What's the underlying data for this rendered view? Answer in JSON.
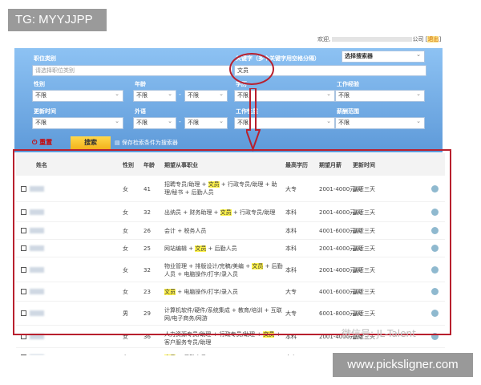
{
  "watermark_tag": "TG: MYYJJPP",
  "header": {
    "welcome": "欢迎,",
    "company_suffix": "公司",
    "logout": "退出"
  },
  "search": {
    "job_category_label": "职位类别",
    "job_category_placeholder": "请选择职位类别",
    "keyword_label": "关键字（多个关键字用空格分隔）",
    "keyword_value": "文员",
    "searcher_select": "选择搜索器",
    "gender_label": "性别",
    "gender_value": "不限",
    "age_label": "年龄",
    "age_from": "不限",
    "age_to": "不限",
    "education_label": "学历",
    "education_value": "不限",
    "experience_label": "工作经验",
    "experience_value": "不限",
    "update_label": "更新时间",
    "update_value": "不限",
    "language_label": "外语",
    "language_from": "不限",
    "language_to": "不限",
    "nature_label": "工作性质",
    "nature_value": "不限",
    "salary_label": "薪酬范围",
    "salary_value": "不限",
    "reset": "重置",
    "search_button": "搜索",
    "save_searcher": "保存检索条件为搜索器"
  },
  "table": {
    "columns": [
      "姓名",
      "性别",
      "年龄",
      "期望从事职业",
      "最高学历",
      "期望月薪",
      "更新时间"
    ],
    "rows": [
      {
        "gender": "女",
        "age": "41",
        "job": [
          "招聘专员/助理 + ",
          "文员",
          " + 行政专员/助理 + 助理/秘书 + 后勤人员"
        ],
        "edu": "大专",
        "salary": "2001-4000元/月",
        "updated": "最近三天"
      },
      {
        "gender": "女",
        "age": "32",
        "job": [
          "出纳员 + 财务助理 + ",
          "文员",
          " + 行政专员/助理"
        ],
        "edu": "本科",
        "salary": "2001-4000元/月",
        "updated": "最近三天"
      },
      {
        "gender": "女",
        "age": "26",
        "job": [
          "会计 + 税务人员",
          "",
          ""
        ],
        "edu": "本科",
        "salary": "4001-6000元/月",
        "updated": "最近三天"
      },
      {
        "gender": "女",
        "age": "25",
        "job": [
          "网站编辑 + ",
          "文员",
          " + 后勤人员"
        ],
        "edu": "本科",
        "salary": "2001-4000元/月",
        "updated": "最近三天"
      },
      {
        "gender": "女",
        "age": "32",
        "job": [
          "物业管理 + 排版设计/完稿/美编 + ",
          "文员",
          " + 后勤人员 + 电脑操作/打字/录入员"
        ],
        "edu": "本科",
        "salary": "2001-4000元/月",
        "updated": "最近三天"
      },
      {
        "gender": "女",
        "age": "23",
        "job": [
          "",
          "文员",
          " + 电脑操作/打字/录入员"
        ],
        "edu": "大专",
        "salary": "4001-6000元/月",
        "updated": "最近三天"
      },
      {
        "gender": "男",
        "age": "29",
        "job": [
          "计算机软件/硬件/系统集成 + 教育/培训 + 互联网/电子商务/网游",
          "",
          ""
        ],
        "edu": "大专",
        "salary": "6001-8000元/月",
        "updated": "最近三天"
      },
      {
        "gender": "女",
        "age": "36",
        "job": [
          "人力资源专员/助理 + 行政专员/助理 + ",
          "文员",
          " + 客户服务专员/助理"
        ],
        "edu": "本科",
        "salary": "2001-4000元/月",
        "updated": "最近三天"
      },
      {
        "gender": "女",
        "age": "35",
        "job": [
          "",
          "文员",
          " + 后勤人员"
        ],
        "edu": "大专",
        "salary": "2001-4000元/月",
        "updated": "最近三天"
      }
    ]
  },
  "wechat_watermark": "微信号: JL-Talent",
  "site_watermark": "www.picksligner.com",
  "colors": {
    "annotation_red": "#b8202e",
    "highlight": "#fff24a",
    "panel_blue": "#6fa8e3"
  }
}
